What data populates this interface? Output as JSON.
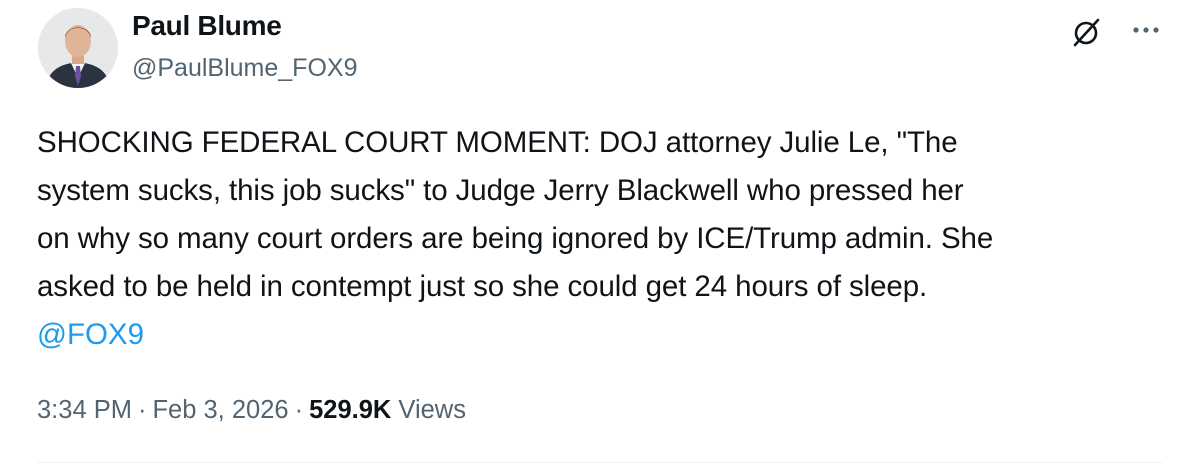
{
  "author": {
    "display_name": "Paul Blume",
    "handle": "@PaulBlume_FOX9"
  },
  "tweet": {
    "text": "SHOCKING FEDERAL COURT MOMENT: DOJ attorney Julie Le, \"The\nsystem sucks, this job sucks\" to Judge Jerry Blackwell who pressed her\non why so many court orders are being ignored by ICE/Trump admin. She\nasked to be held in contempt just so she could get 24 hours of sleep.",
    "mention": "@FOX9"
  },
  "meta": {
    "time": "3:34 PM",
    "separator": "·",
    "date": "Feb 3, 2026",
    "views_count": "529.9K",
    "views_label": "Views"
  },
  "icons": {
    "grok": "grok-icon",
    "more": "more-icon"
  },
  "colors": {
    "text": "#0f1419",
    "secondary": "#536471",
    "link": "#1d9bf0"
  }
}
